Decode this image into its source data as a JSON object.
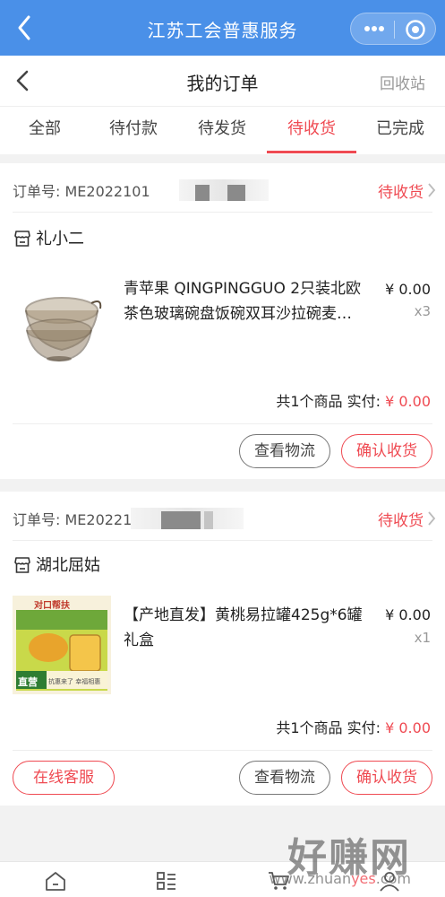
{
  "mini_app": {
    "title": "江苏工会普惠服务"
  },
  "header": {
    "title": "我的订单",
    "right_link": "回收站"
  },
  "tabs": [
    {
      "label": "全部"
    },
    {
      "label": "待付款"
    },
    {
      "label": "待发货"
    },
    {
      "label": "待收货",
      "active": true
    },
    {
      "label": "已完成"
    }
  ],
  "orders": [
    {
      "order_no": "订单号: ME2022101",
      "status": "待收货",
      "shop": "礼小二",
      "product_name": "青苹果 QINGPINGGUO 2只装北欧茶色玻璃碗盘饭碗双耳沙拉碗麦…",
      "price": "¥ 0.00",
      "qty": "x3",
      "count_text": "共1个商品",
      "paid_label": "实付:",
      "paid_value": "¥ 0.00",
      "buttons": {
        "logistics": "查看物流",
        "confirm": "确认收货"
      }
    },
    {
      "order_no": "订单号: ME20221",
      "status": "待收货",
      "shop": "湖北屈姑",
      "product_name": "【产地直发】黄桃易拉罐425g*6罐礼盒",
      "price": "¥ 0.00",
      "qty": "x1",
      "count_text": "共1个商品",
      "paid_label": "实付:",
      "paid_value": "¥ 0.00",
      "buttons": {
        "service": "在线客服",
        "logistics": "查看物流",
        "confirm": "确认收货"
      },
      "thumb_text": {
        "banner": "对口帮扶",
        "tag": "直营",
        "slogan": "抗惠来了 幸福相惠"
      }
    }
  ],
  "watermark": {
    "big": "好赚网",
    "small_pre": "www.zhuan",
    "small_hl": "yes",
    "small_post": ".com"
  },
  "colors": {
    "brand_blue": "#4a90e8",
    "accent_red": "#ef4a52"
  }
}
